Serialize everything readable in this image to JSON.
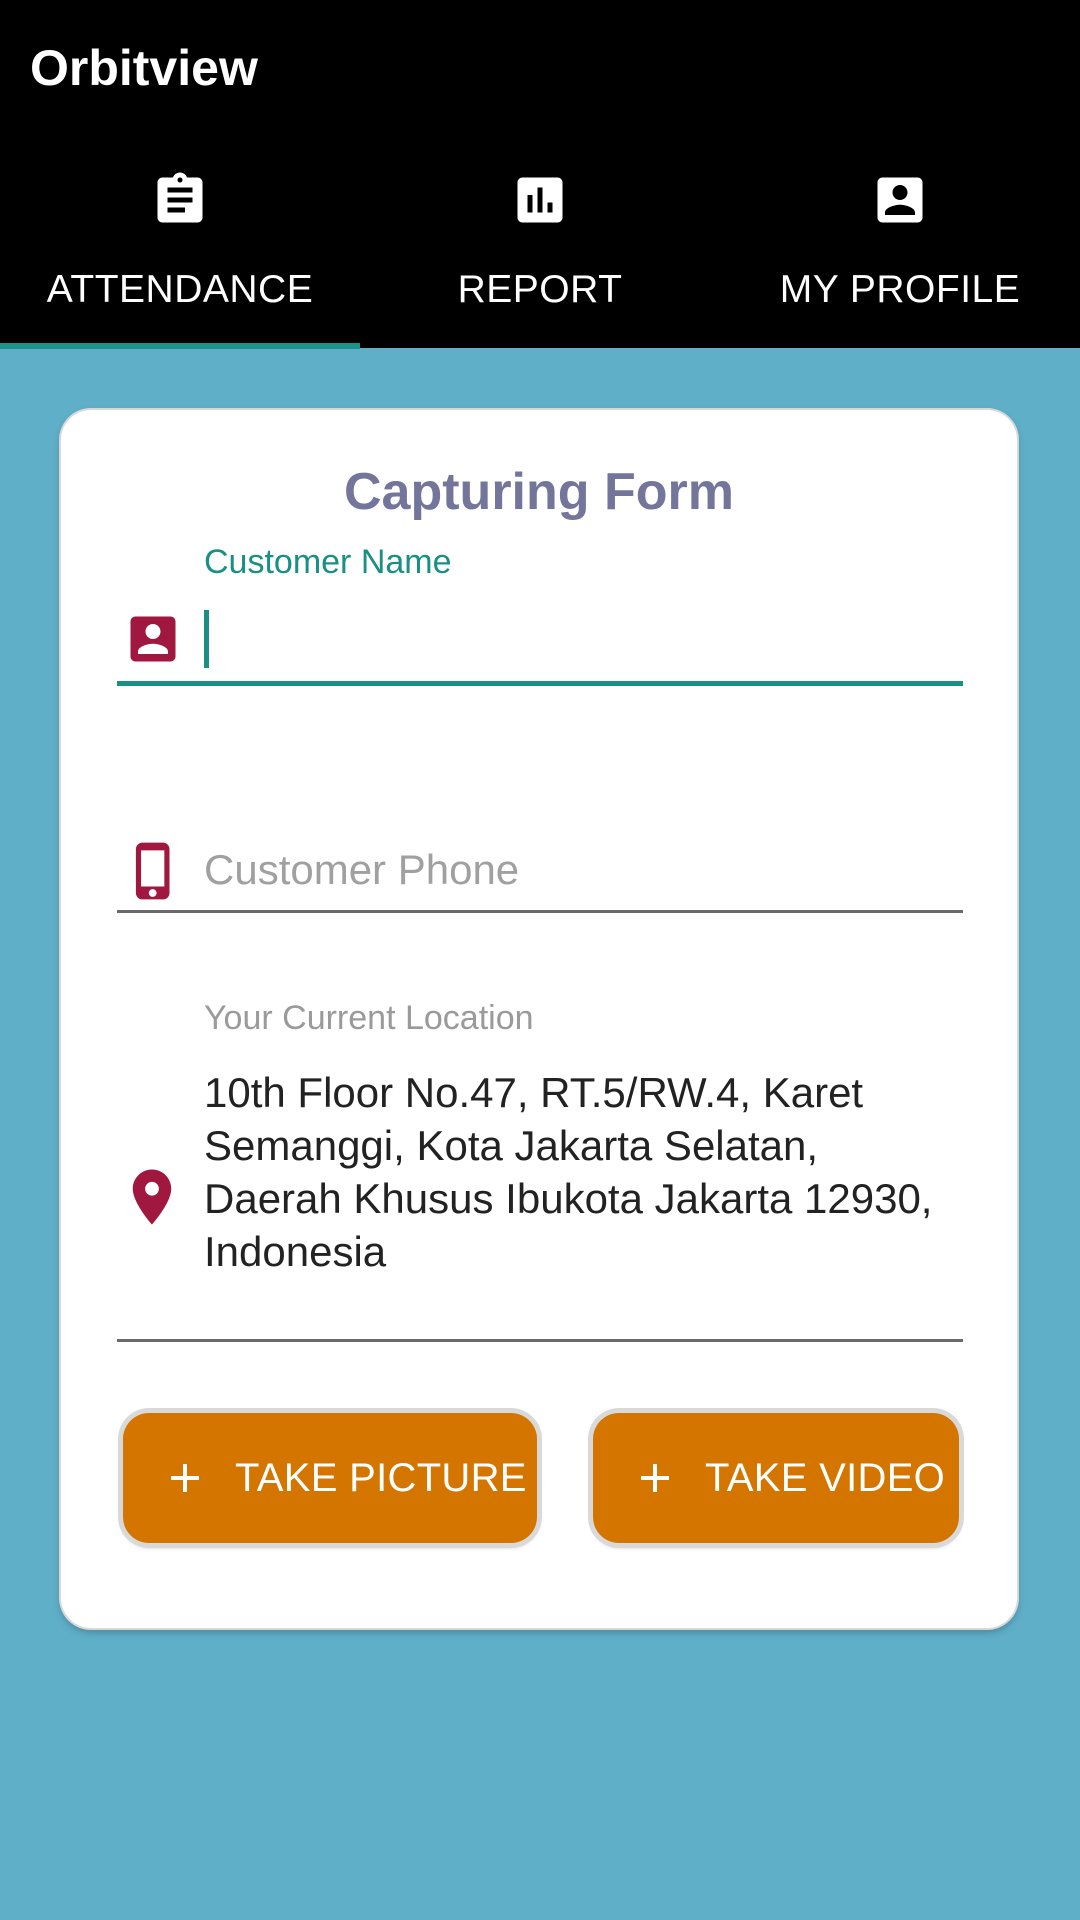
{
  "app": {
    "title": "Orbitview"
  },
  "tabs": [
    {
      "label": "ATTENDANCE",
      "icon": "clipboard-icon",
      "selected": true
    },
    {
      "label": "REPORT",
      "icon": "bar-chart-icon",
      "selected": false
    },
    {
      "label": "MY PROFILE",
      "icon": "account-box-icon",
      "selected": false
    }
  ],
  "form": {
    "title": "Capturing Form",
    "customer_name": {
      "label": "Customer Name",
      "value": "",
      "icon": "account-box-icon"
    },
    "customer_phone": {
      "placeholder": "Customer Phone",
      "value": "",
      "icon": "smartphone-icon"
    },
    "location": {
      "label": "Your Current Location",
      "value": "10th Floor No.47, RT.5/RW.4, Karet Semanggi, Kota Jakarta Selatan, Daerah Khusus Ibukota Jakarta 12930, Indonesia",
      "icon": "map-pin-icon"
    },
    "take_picture_label": "TAKE PICTURE",
    "take_video_label": "TAKE VIDEO"
  },
  "colors": {
    "appbar": "#000000",
    "background": "#5fafc8",
    "accent": "#1a8f83",
    "icon": "#a0173f",
    "button": "#d47500",
    "title": "#73769a"
  }
}
